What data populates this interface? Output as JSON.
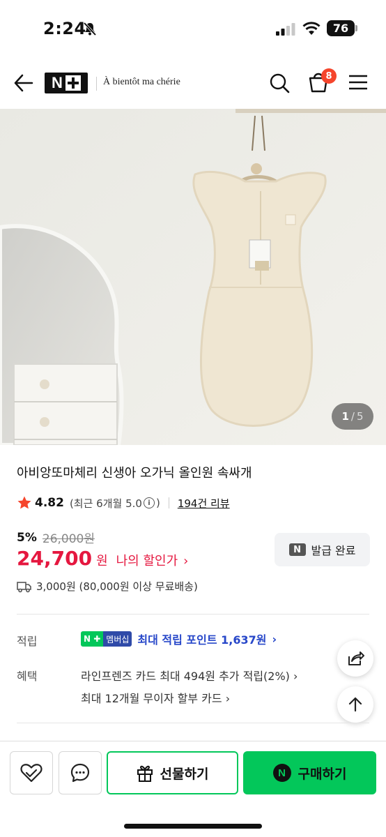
{
  "status_bar": {
    "time": "2:24",
    "battery": "76"
  },
  "header": {
    "brand_name": "À bientôt ma chérie",
    "cart_count": "8"
  },
  "gallery": {
    "current": "1",
    "separator": "/",
    "total": "5"
  },
  "product": {
    "title": "아비앙또마체리 신생아 오가닉 올인원 속싸개",
    "rating": "4.82",
    "rating_note_prefix": "(최근 6개월 5.0",
    "rating_note_suffix": ")",
    "review_count": "194건 리뷰",
    "discount_rate": "5%",
    "original_price": "26,000원",
    "sale_price": "24,700",
    "won": "원",
    "my_sale_label": "나의 할인가",
    "shipping": "3,000원 (80,000원 이상 무료배송)"
  },
  "coupon": {
    "label": "발급 완료",
    "badge": "N"
  },
  "benefits": {
    "point_label": "적립",
    "membership_badge": "멤버십",
    "max_point": "최대 적립 포인트 1,637원",
    "benefit_label": "혜택",
    "benefit_1": "라인프렌즈 카드 최대 494원 추가 적립(2%)",
    "benefit_2": "최대 12개월 무이자 할부 카드"
  },
  "bottom_bar": {
    "gift_label": "선물하기",
    "buy_label": "구매하기",
    "buy_badge": "N"
  },
  "colors": {
    "naver_green": "#03c75a",
    "price_red": "#e5173f",
    "point_blue": "#2747c9",
    "badge_red": "#f5452c"
  }
}
